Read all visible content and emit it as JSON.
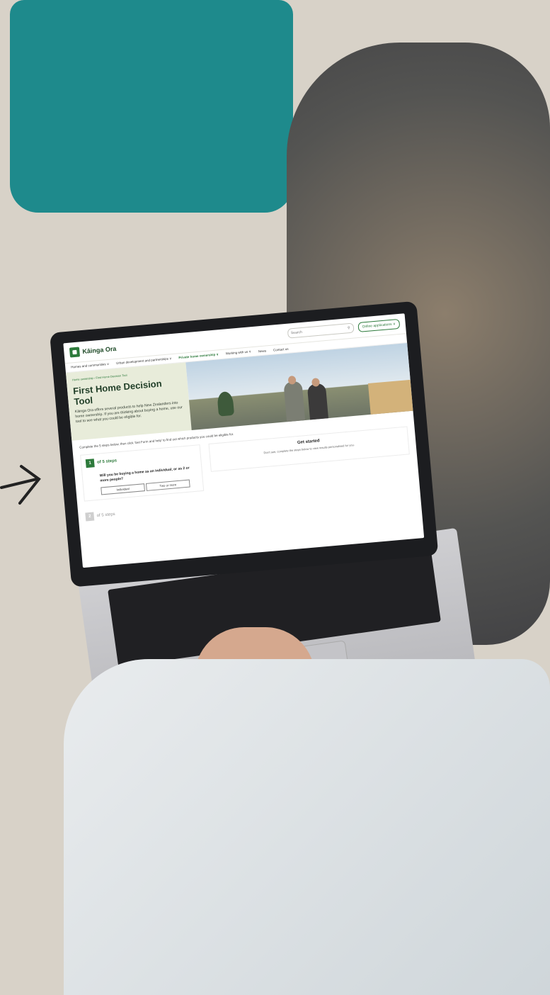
{
  "site": {
    "logo_text": "Kāinga Ora",
    "search_placeholder": "Search",
    "apply_button": "Online applications ∨",
    "nav": [
      "Homes and communities ∨",
      "Urban development and partnerships ∨",
      "Private home ownership ∨",
      "Working with us ∨",
      "News",
      "Contact us"
    ],
    "nav_active_index": 2
  },
  "hero": {
    "breadcrumb": "Home ownership › First Home Decision Tool",
    "title": "First Home Decision Tool",
    "description": "Kāinga Ora offers several products to help New Zealanders into home ownership. If you are thinking about buying a home, use our tool to see what you could be eligible for."
  },
  "body": {
    "intro": "Complete the 5 steps below, then click 'Get Form and help' to find out which products you could be eligible for.",
    "step1": {
      "number": "1",
      "label": "of 5 steps",
      "question": "Will you be buying a home as an individual, or as 2 or more people?",
      "choices": [
        "Individual",
        "Two or more"
      ]
    },
    "side": {
      "title": "Get started",
      "description": "Don't see, complete the steps below to view results personalised for you."
    },
    "step2": {
      "number": "2",
      "label": "of 5 steps"
    }
  }
}
